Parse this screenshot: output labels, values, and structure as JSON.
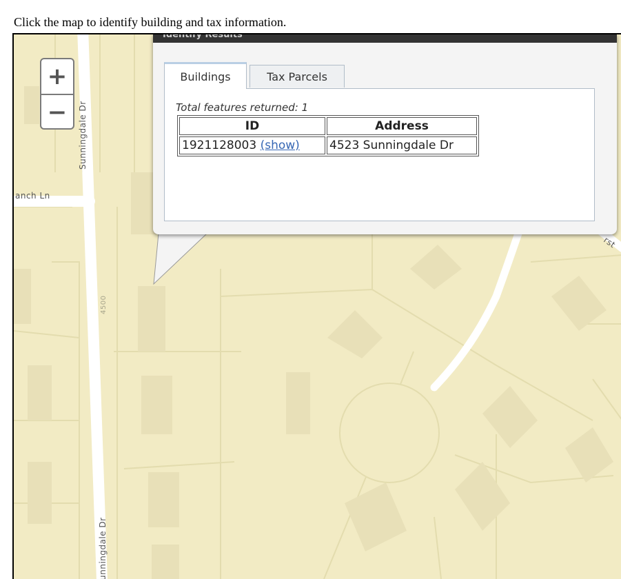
{
  "instructions": "Click the map to identify building and tax information.",
  "map": {
    "background_color": "#f2ebc4",
    "street_labels": {
      "sunningdale_top": "Sunningdale Dr",
      "ranch_ln": "anch Ln",
      "hurst": "rst",
      "number_4500": "4500",
      "sunningdale_bottom": "unningdale Dr"
    },
    "zoom": {
      "in_label": "+",
      "out_label": "−"
    }
  },
  "popup": {
    "title": "Identify Results",
    "tabs": [
      {
        "label": "Buildings",
        "active": true
      },
      {
        "label": "Tax Parcels",
        "active": false
      }
    ],
    "total_features": "Total features returned: 1",
    "table": {
      "headers": {
        "id": "ID",
        "address": "Address"
      },
      "rows": [
        {
          "id": "1921128003",
          "link": "(show)",
          "address": "4523 Sunningdale Dr"
        }
      ]
    }
  }
}
